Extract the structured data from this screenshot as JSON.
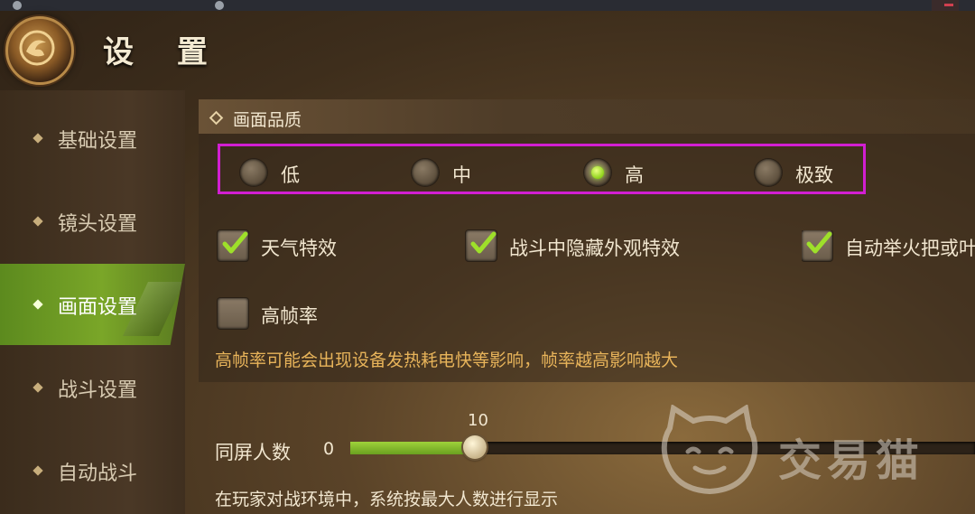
{
  "header": {
    "title": "设 置"
  },
  "sidebar": {
    "items": [
      {
        "label": "基础设置",
        "active": false
      },
      {
        "label": "镜头设置",
        "active": false
      },
      {
        "label": "画面设置",
        "active": true
      },
      {
        "label": "战斗设置",
        "active": false
      },
      {
        "label": "自动战斗",
        "active": false
      }
    ]
  },
  "quality": {
    "section_title": "画面品质",
    "options": [
      "低",
      "中",
      "高",
      "极致"
    ],
    "selected": "高"
  },
  "effects": {
    "weather": {
      "label": "天气特效",
      "checked": true
    },
    "hide_in_battle": {
      "label": "战斗中隐藏外观特效",
      "checked": true
    },
    "auto_torch": {
      "label": "自动举火把或叶",
      "checked": true
    },
    "high_fps": {
      "label": "高帧率",
      "checked": false
    },
    "high_fps_note": "高帧率可能会出现设备发热耗电快等影响，帧率越高影响越大"
  },
  "players_slider": {
    "label": "同屏人数",
    "min_label": "0",
    "value": "10",
    "fraction": 0.2,
    "note": "在玩家对战环境中，系统按最大人数进行显示"
  },
  "watermark": {
    "text": "交易猫"
  },
  "colors": {
    "accent_green": "#7aa628",
    "highlight_magenta": "#d21fd2",
    "note_orange": "#e8b45a"
  }
}
